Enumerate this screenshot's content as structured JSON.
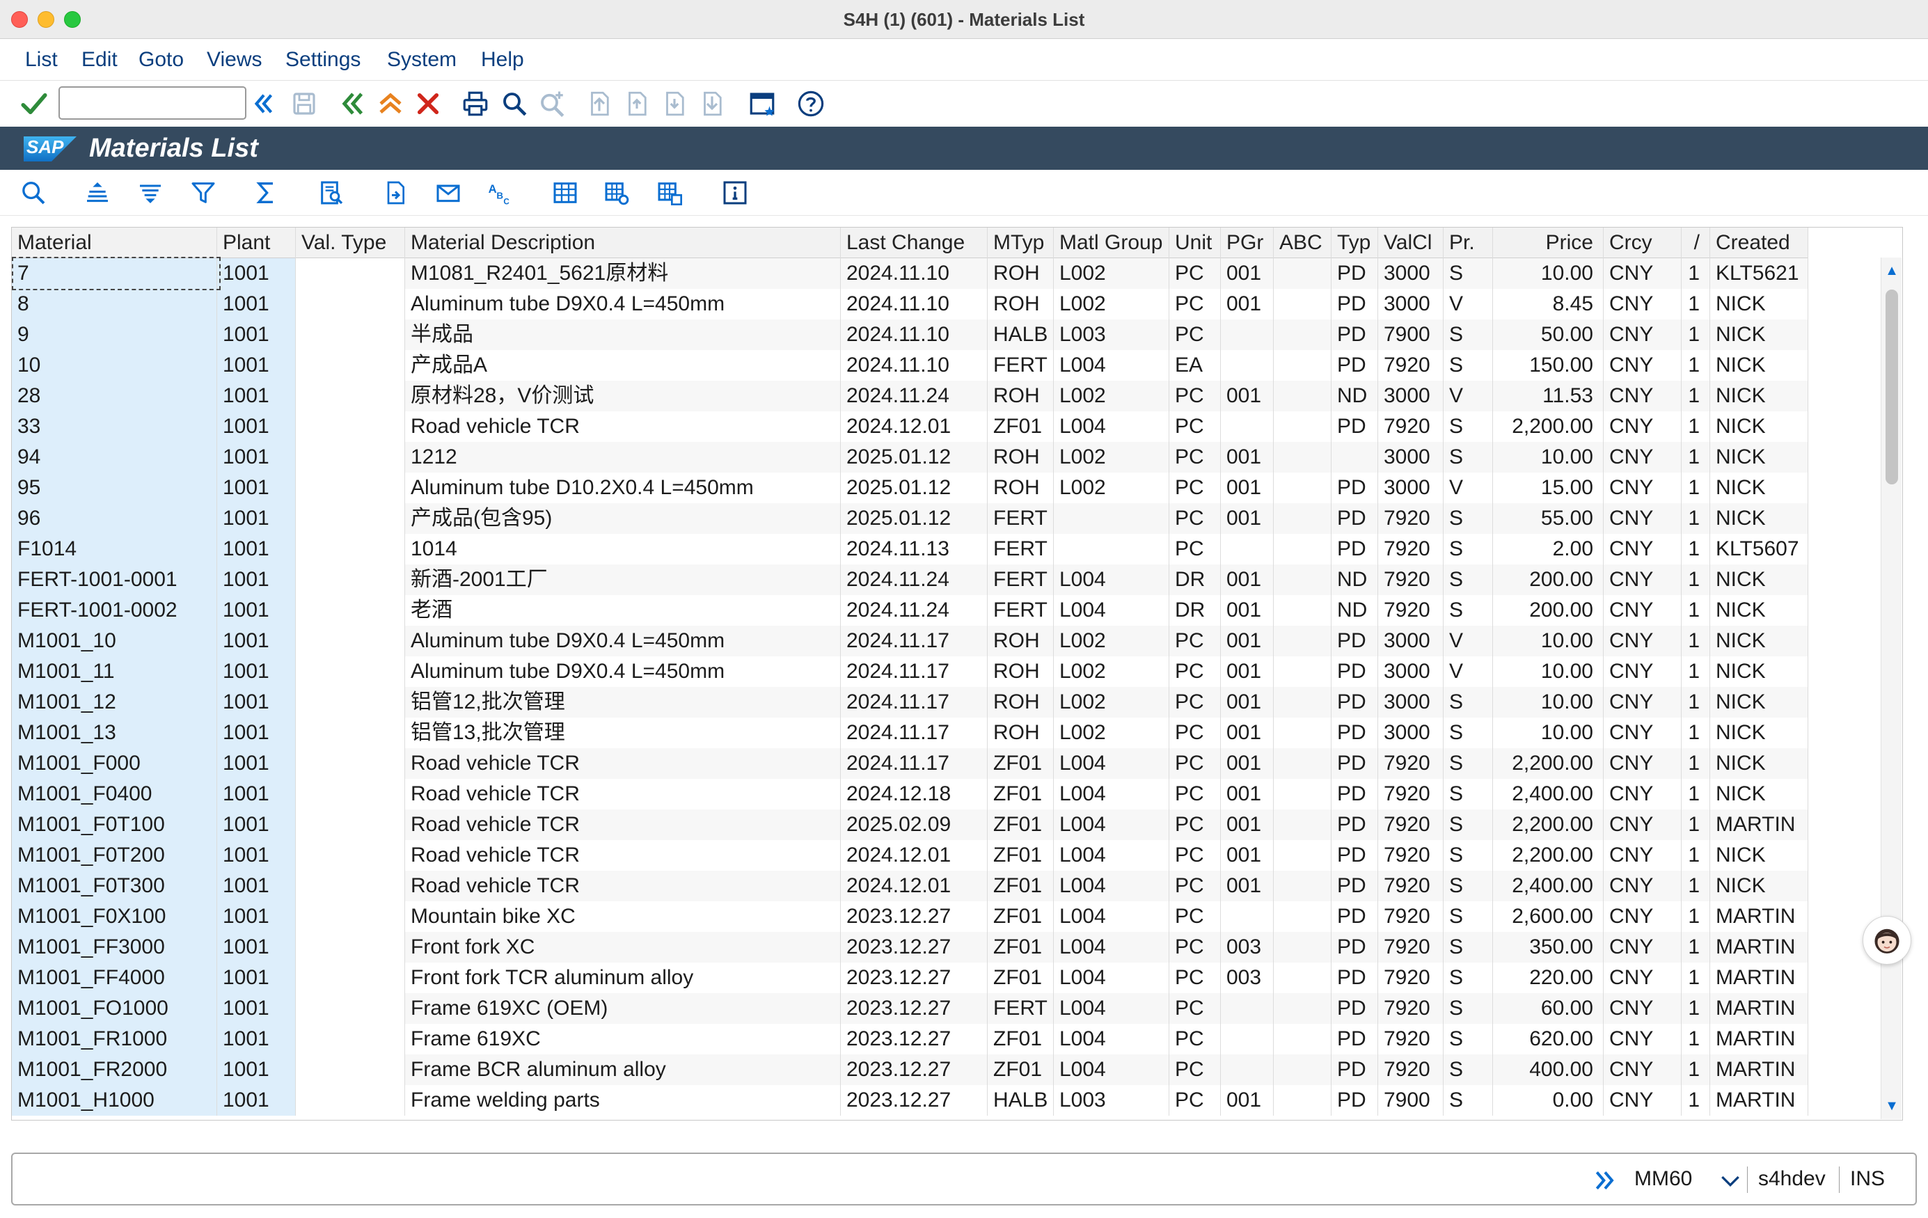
{
  "window": {
    "title": "S4H (1) (601) - Materials List"
  },
  "menu": [
    "List",
    "Edit",
    "Goto",
    "Views",
    "Settings",
    "System",
    "Help"
  ],
  "command_field": {
    "value": ""
  },
  "banner": {
    "logo_text": "SAP",
    "title": "Materials List"
  },
  "columns": [
    "Material",
    "Plant",
    "Val. Type",
    "Material Description",
    "Last Change",
    "MTyp",
    "Matl Group",
    "Unit",
    "PGr",
    "ABC",
    "Typ",
    "ValCl",
    "Pr.",
    "Price",
    "Crcy",
    "/",
    "Created"
  ],
  "rows": [
    [
      "7",
      "1001",
      "",
      "M1081_R2401_5621原材料",
      "2024.11.10",
      "ROH",
      "L002",
      "PC",
      "001",
      "",
      "PD",
      "3000",
      "S",
      "10.00",
      "CNY",
      "1",
      "KLT5621"
    ],
    [
      "8",
      "1001",
      "",
      "Aluminum tube D9X0.4 L=450mm",
      "2024.11.10",
      "ROH",
      "L002",
      "PC",
      "001",
      "",
      "PD",
      "3000",
      "V",
      "8.45",
      "CNY",
      "1",
      "NICK"
    ],
    [
      "9",
      "1001",
      "",
      "半成品",
      "2024.11.10",
      "HALB",
      "L003",
      "PC",
      "",
      "",
      "PD",
      "7900",
      "S",
      "50.00",
      "CNY",
      "1",
      "NICK"
    ],
    [
      "10",
      "1001",
      "",
      "产成品A",
      "2024.11.10",
      "FERT",
      "L004",
      "EA",
      "",
      "",
      "PD",
      "7920",
      "S",
      "150.00",
      "CNY",
      "1",
      "NICK"
    ],
    [
      "28",
      "1001",
      "",
      "原材料28，V价测试",
      "2024.11.24",
      "ROH",
      "L002",
      "PC",
      "001",
      "",
      "ND",
      "3000",
      "V",
      "11.53",
      "CNY",
      "1",
      "NICK"
    ],
    [
      "33",
      "1001",
      "",
      "Road vehicle TCR",
      "2024.12.01",
      "ZF01",
      "L004",
      "PC",
      "",
      "",
      "PD",
      "7920",
      "S",
      "2,200.00",
      "CNY",
      "1",
      "NICK"
    ],
    [
      "94",
      "1001",
      "",
      "1212",
      "2025.01.12",
      "ROH",
      "L002",
      "PC",
      "001",
      "",
      "",
      "3000",
      "S",
      "10.00",
      "CNY",
      "1",
      "NICK"
    ],
    [
      "95",
      "1001",
      "",
      "Aluminum tube D10.2X0.4 L=450mm",
      "2025.01.12",
      "ROH",
      "L002",
      "PC",
      "001",
      "",
      "PD",
      "3000",
      "V",
      "15.00",
      "CNY",
      "1",
      "NICK"
    ],
    [
      "96",
      "1001",
      "",
      "产成品(包含95)",
      "2025.01.12",
      "FERT",
      "",
      "PC",
      "001",
      "",
      "PD",
      "7920",
      "S",
      "55.00",
      "CNY",
      "1",
      "NICK"
    ],
    [
      "F1014",
      "1001",
      "",
      "1014",
      "2024.11.13",
      "FERT",
      "",
      "PC",
      "",
      "",
      "PD",
      "7920",
      "S",
      "2.00",
      "CNY",
      "1",
      "KLT5607"
    ],
    [
      "FERT-1001-0001",
      "1001",
      "",
      "新酒-2001工厂",
      "2024.11.24",
      "FERT",
      "L004",
      "DR",
      "001",
      "",
      "ND",
      "7920",
      "S",
      "200.00",
      "CNY",
      "1",
      "NICK"
    ],
    [
      "FERT-1001-0002",
      "1001",
      "",
      "老酒",
      "2024.11.24",
      "FERT",
      "L004",
      "DR",
      "001",
      "",
      "ND",
      "7920",
      "S",
      "200.00",
      "CNY",
      "1",
      "NICK"
    ],
    [
      "M1001_10",
      "1001",
      "",
      "Aluminum tube D9X0.4 L=450mm",
      "2024.11.17",
      "ROH",
      "L002",
      "PC",
      "001",
      "",
      "PD",
      "3000",
      "V",
      "10.00",
      "CNY",
      "1",
      "NICK"
    ],
    [
      "M1001_11",
      "1001",
      "",
      "Aluminum tube D9X0.4 L=450mm",
      "2024.11.17",
      "ROH",
      "L002",
      "PC",
      "001",
      "",
      "PD",
      "3000",
      "V",
      "10.00",
      "CNY",
      "1",
      "NICK"
    ],
    [
      "M1001_12",
      "1001",
      "",
      "铝管12,批次管理",
      "2024.11.17",
      "ROH",
      "L002",
      "PC",
      "001",
      "",
      "PD",
      "3000",
      "S",
      "10.00",
      "CNY",
      "1",
      "NICK"
    ],
    [
      "M1001_13",
      "1001",
      "",
      "铝管13,批次管理",
      "2024.11.17",
      "ROH",
      "L002",
      "PC",
      "001",
      "",
      "PD",
      "3000",
      "S",
      "10.00",
      "CNY",
      "1",
      "NICK"
    ],
    [
      "M1001_F000",
      "1001",
      "",
      "Road vehicle TCR",
      "2024.11.17",
      "ZF01",
      "L004",
      "PC",
      "001",
      "",
      "PD",
      "7920",
      "S",
      "2,200.00",
      "CNY",
      "1",
      "NICK"
    ],
    [
      "M1001_F0400",
      "1001",
      "",
      "Road vehicle TCR",
      "2024.12.18",
      "ZF01",
      "L004",
      "PC",
      "001",
      "",
      "PD",
      "7920",
      "S",
      "2,400.00",
      "CNY",
      "1",
      "NICK"
    ],
    [
      "M1001_F0T100",
      "1001",
      "",
      "Road vehicle TCR",
      "2025.02.09",
      "ZF01",
      "L004",
      "PC",
      "001",
      "",
      "PD",
      "7920",
      "S",
      "2,200.00",
      "CNY",
      "1",
      "MARTIN"
    ],
    [
      "M1001_F0T200",
      "1001",
      "",
      "Road vehicle TCR",
      "2024.12.01",
      "ZF01",
      "L004",
      "PC",
      "001",
      "",
      "PD",
      "7920",
      "S",
      "2,200.00",
      "CNY",
      "1",
      "NICK"
    ],
    [
      "M1001_F0T300",
      "1001",
      "",
      "Road vehicle TCR",
      "2024.12.01",
      "ZF01",
      "L004",
      "PC",
      "001",
      "",
      "PD",
      "7920",
      "S",
      "2,400.00",
      "CNY",
      "1",
      "NICK"
    ],
    [
      "M1001_F0X100",
      "1001",
      "",
      "Mountain bike XC",
      "2023.12.27",
      "ZF01",
      "L004",
      "PC",
      "",
      "",
      "PD",
      "7920",
      "S",
      "2,600.00",
      "CNY",
      "1",
      "MARTIN"
    ],
    [
      "M1001_FF3000",
      "1001",
      "",
      "Front fork XC",
      "2023.12.27",
      "ZF01",
      "L004",
      "PC",
      "003",
      "",
      "PD",
      "7920",
      "S",
      "350.00",
      "CNY",
      "1",
      "MARTIN"
    ],
    [
      "M1001_FF4000",
      "1001",
      "",
      "Front fork TCR aluminum alloy",
      "2023.12.27",
      "ZF01",
      "L004",
      "PC",
      "003",
      "",
      "PD",
      "7920",
      "S",
      "220.00",
      "CNY",
      "1",
      "MARTIN"
    ],
    [
      "M1001_FO1000",
      "1001",
      "",
      "Frame 619XC (OEM)",
      "2023.12.27",
      "FERT",
      "L004",
      "PC",
      "",
      "",
      "PD",
      "7920",
      "S",
      "60.00",
      "CNY",
      "1",
      "MARTIN"
    ],
    [
      "M1001_FR1000",
      "1001",
      "",
      "Frame 619XC",
      "2023.12.27",
      "ZF01",
      "L004",
      "PC",
      "",
      "",
      "PD",
      "7920",
      "S",
      "620.00",
      "CNY",
      "1",
      "MARTIN"
    ],
    [
      "M1001_FR2000",
      "1001",
      "",
      "Frame BCR aluminum alloy",
      "2023.12.27",
      "ZF01",
      "L004",
      "PC",
      "",
      "",
      "PD",
      "7920",
      "S",
      "400.00",
      "CNY",
      "1",
      "MARTIN"
    ],
    [
      "M1001_H1000",
      "1001",
      "",
      "Frame welding parts",
      "2023.12.27",
      "HALB",
      "L003",
      "PC",
      "001",
      "",
      "PD",
      "7900",
      "S",
      "0.00",
      "CNY",
      "1",
      "MARTIN"
    ]
  ],
  "status_bar": {
    "transaction": "MM60",
    "system": "s4hdev",
    "mode": "INS"
  },
  "colors": {
    "banner": "#354a5f",
    "key_column": "#ddeefb",
    "menu_text": "#0a3e7e",
    "check_green": "#2e8b3a",
    "cancel_red": "#d0261b"
  }
}
